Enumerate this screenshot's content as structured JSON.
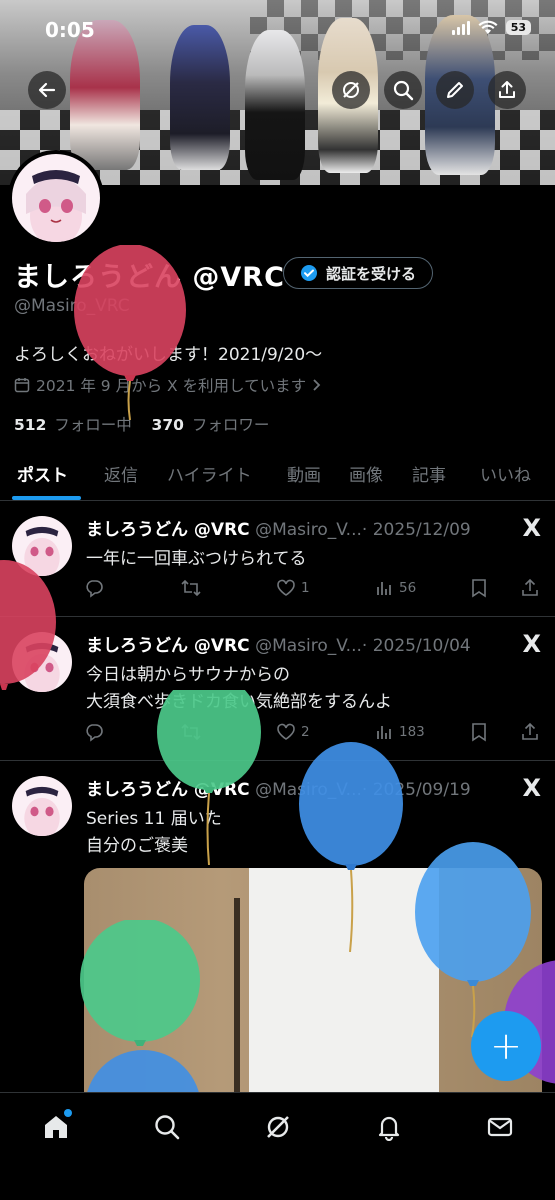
{
  "status": {
    "time": "0:05",
    "battery": "53"
  },
  "profile": {
    "name": "ましろうどん @VRC",
    "verify_label": "認証を受ける",
    "handle": "@Masiro_VRC",
    "bio": "よろしくおねがいします！2021/9/20～",
    "joined": "2021 年 9 月から X を利用しています",
    "following_count": "512",
    "following_label": "フォロー中",
    "followers_count": "370",
    "followers_label": "フォロワー"
  },
  "tabs": [
    "ポスト",
    "返信",
    "ハイライト",
    "動画",
    "画像",
    "記事",
    "いいね"
  ],
  "posts": [
    {
      "name": "ましろうどん @VRC",
      "handle": "@Masiro_V...",
      "date": "· 2025/12/09",
      "line1": "一年に一回車ぶつけられてる",
      "line2": "",
      "likes": "1",
      "views": "56"
    },
    {
      "name": "ましろうどん @VRC",
      "handle": "@Masiro_V...",
      "date": "· 2025/10/04",
      "line1": "今日は朝からサウナからの",
      "line2": "大須食べ歩きドカ食い気絶部をするんよ",
      "likes": "2",
      "views": "183"
    },
    {
      "name": "ましろうどん @VRC",
      "handle": "@Masiro_V...",
      "date": "· 2025/09/19",
      "line1": "Series 11 届いた",
      "line2": "自分のご褒美"
    }
  ],
  "x_logo": "X",
  "fab_label": "+",
  "colors": {
    "accent": "#1d9bf0",
    "muted": "#71767b",
    "divider": "#2f3336",
    "balloon_red": "#d9435f",
    "balloon_green": "#4cc98a",
    "balloon_blue": "#3f8fe6",
    "balloon_purple": "#8e3fd0"
  }
}
